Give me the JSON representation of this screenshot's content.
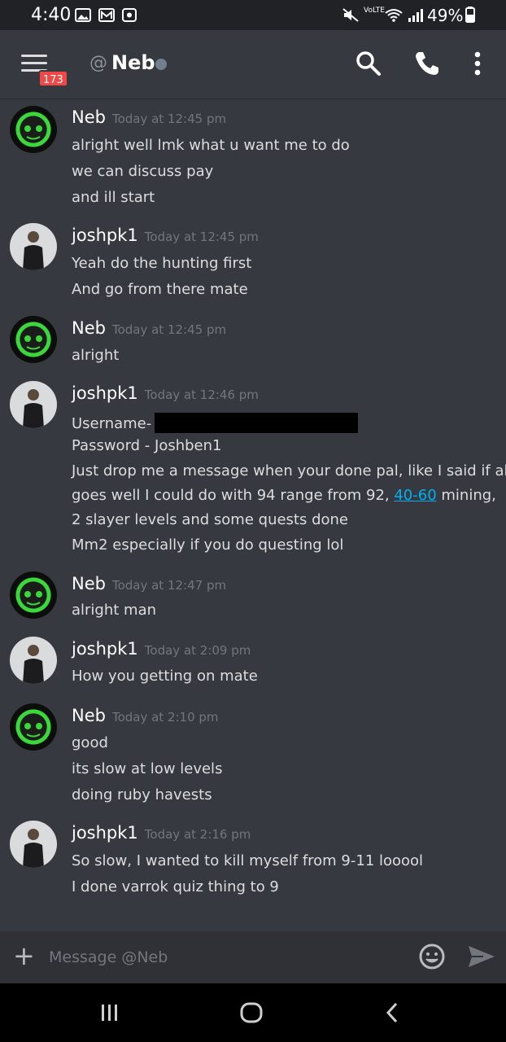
{
  "status_bar": {
    "time": "4:40",
    "battery": "49%",
    "network": "VoLTE"
  },
  "header": {
    "unread_badge": "173",
    "at": "@",
    "channel_name": "Neb",
    "status_color": "#747f8d",
    "icons": [
      "menu-icon",
      "search-icon",
      "phone-icon",
      "more-icon"
    ]
  },
  "messages": [
    {
      "author": "Neb",
      "time": "Today at 12:45 pm",
      "lines": [
        "alright well lmk what u want me to do",
        "we can discuss pay",
        "and ill start"
      ]
    },
    {
      "author": "joshpk1",
      "time": "Today at 12:45 pm",
      "lines": [
        "Yeah do the hunting first",
        "And go from there mate"
      ]
    },
    {
      "author": "Neb",
      "time": "Today at 12:45 pm",
      "lines": [
        "alright"
      ]
    },
    {
      "author": "joshpk1",
      "time": "Today at 12:46 pm",
      "username_label": "Username-",
      "password_line": "Password - Joshben1",
      "body_1": "Just drop me a message when your done pal, like I said if all",
      "body_2_pre": "goes well I could do with 94 range from 92, ",
      "body_2_link": "40-60",
      "body_2_post": " mining,",
      "body_3": "2 slayer levels and some quests done",
      "body_4": "Mm2 especially if you do questing lol"
    },
    {
      "author": "Neb",
      "time": "Today at 12:47 pm",
      "lines": [
        "alright man"
      ]
    },
    {
      "author": "joshpk1",
      "time": "Today at 2:09 pm",
      "lines": [
        "How you getting on mate"
      ]
    },
    {
      "author": "Neb",
      "time": "Today at 2:10 pm",
      "lines": [
        "good",
        "its slow at low levels",
        "doing ruby havests"
      ]
    },
    {
      "author": "joshpk1",
      "time": "Today at 2:16 pm",
      "lines": [
        "So slow, I wanted to kill myself from 9-11 looool",
        "I done varrok quiz thing to 9"
      ]
    }
  ],
  "composer": {
    "placeholder": "Message @Neb"
  },
  "colors": {
    "background": "#36393f",
    "link": "#00b0f4",
    "badge": "#f04747"
  }
}
